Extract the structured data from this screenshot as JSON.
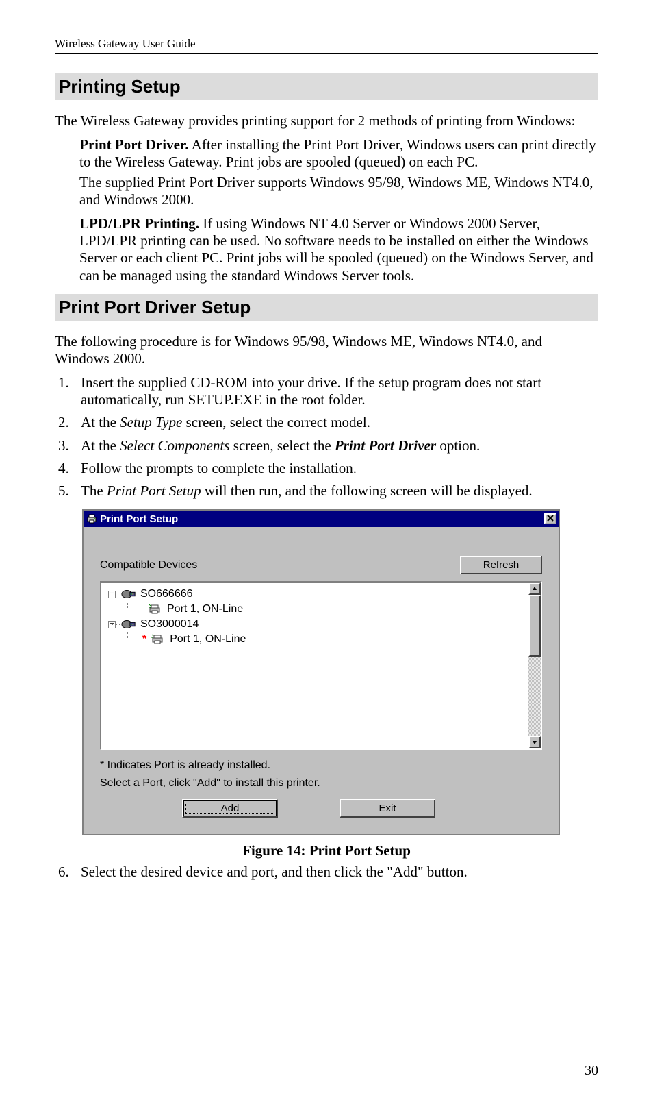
{
  "header": {
    "title": "Wireless Gateway User Guide"
  },
  "section1": {
    "heading": "Printing Setup",
    "intro": "The Wireless Gateway provides printing support for 2 methods of printing from Windows:",
    "m1_lead": "Print Port Driver.",
    "m1_rest": "  After installing the Print Port Driver, Windows users can print directly to the Wireless Gateway. Print jobs are spooled (queued) on each PC.",
    "m1_line2": "The supplied Print Port Driver supports Windows 95/98, Windows ME, Windows NT4.0, and Windows 2000.",
    "m2_lead": "LPD/LPR Printing.",
    "m2_rest": "  If using Windows NT 4.0 Server or Windows 2000 Server, LPD/LPR printing can be used. No software needs to be installed on either the Windows Server or each client PC. Print jobs will be spooled (queued) on the Windows Server, and can be managed using the standard Windows Server tools."
  },
  "section2": {
    "heading": "Print Port Driver Setup",
    "intro": "The following procedure is for Windows 95/98, Windows ME, Windows NT4.0, and Windows 2000.",
    "steps": {
      "s1": "Insert the supplied CD-ROM into your drive. If the setup program does not start automatically, run SETUP.EXE in the root folder.",
      "s2_a": "At the ",
      "s2_i": "Setup Type",
      "s2_b": " screen, select the correct model.",
      "s3_a": "At the ",
      "s3_i": "Select Components",
      "s3_b": " screen, select the ",
      "s3_bi": "Print Port Driver",
      "s3_c": " option.",
      "s4": "Follow the prompts to complete the installation.",
      "s5_a": "The ",
      "s5_i": "Print Port Setup",
      "s5_b": " will then run, and the following screen will be displayed.",
      "s6": "Select the desired device and port, and then click the \"Add\" button."
    }
  },
  "dialog": {
    "title": "Print Port Setup",
    "compatible_label": "Compatible Devices",
    "refresh": "Refresh",
    "tree": {
      "d1": "SO666666",
      "d1p1": "Port 1, ON-Line",
      "d2": "SO3000014",
      "d2p1": "Port 1, ON-Line"
    },
    "note1": "* Indicates Port is already installed.",
    "note2": "Select a Port, click \"Add\" to install this printer.",
    "add": "Add",
    "exit": "Exit"
  },
  "figure_caption": "Figure 14: Print Port Setup",
  "page_number": "30"
}
